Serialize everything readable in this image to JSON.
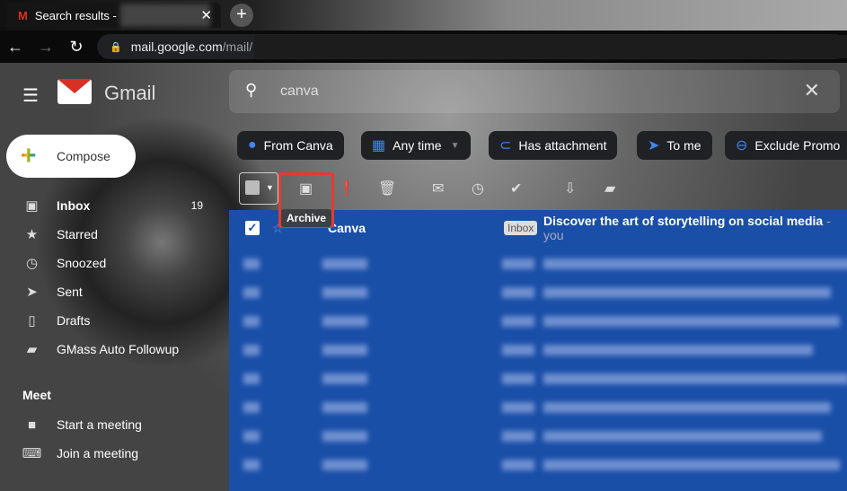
{
  "browser": {
    "tab_title": "Search results -",
    "url_host": "mail.google.com",
    "url_path": "/mail/"
  },
  "header": {
    "brand": "Gmail",
    "search_query": "canva"
  },
  "compose_label": "Compose",
  "sidebar": {
    "items": [
      {
        "label": "Inbox",
        "icon": "inbox-icon",
        "count": "19",
        "bold": true
      },
      {
        "label": "Starred",
        "icon": "star-icon"
      },
      {
        "label": "Snoozed",
        "icon": "clock-icon"
      },
      {
        "label": "Sent",
        "icon": "send-icon"
      },
      {
        "label": "Drafts",
        "icon": "draft-icon"
      },
      {
        "label": "GMass Auto Followup",
        "icon": "label-icon"
      }
    ],
    "meet_heading": "Meet",
    "meet_items": [
      {
        "label": "Start a meeting",
        "icon": "video-icon"
      },
      {
        "label": "Join a meeting",
        "icon": "keyboard-icon"
      }
    ]
  },
  "chips": [
    {
      "label": "From Canva",
      "icon": "person-icon"
    },
    {
      "label": "Any time",
      "icon": "calendar-icon"
    },
    {
      "label": "Has attachment",
      "icon": "paperclip-icon"
    },
    {
      "label": "To me",
      "icon": "send-icon"
    },
    {
      "label": "Exclude Promo",
      "icon": "minus-circle-icon"
    }
  ],
  "toolbar": {
    "tooltip": "Archive"
  },
  "emails": [
    {
      "sender": "Canva",
      "badge": "Inbox",
      "subject": "Discover the art of storytelling on social media",
      "snippet": " - you",
      "selected": true
    }
  ],
  "colors": {
    "list_bg": "#1a4fa8",
    "highlight": "#e53935",
    "chip_icon": "#4285f4"
  }
}
